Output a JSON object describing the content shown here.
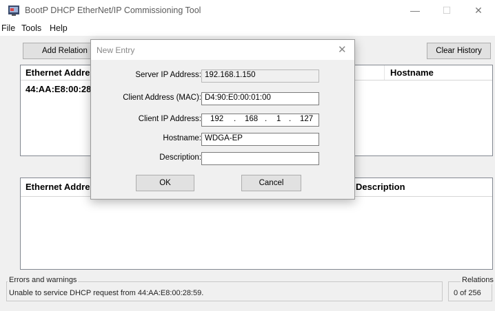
{
  "window": {
    "title": "BootP DHCP EtherNet/IP Commissioning Tool",
    "minimize_glyph": "—",
    "maximize_glyph": "☐",
    "close_glyph": "✕"
  },
  "menu": {
    "file": "File",
    "tools": "Tools",
    "help": "Help"
  },
  "toolbar": {
    "add_relation": "Add Relation",
    "clear_history": "Clear History"
  },
  "top_list": {
    "col_ethernet": "Ethernet Address",
    "col_hostname": "Hostname",
    "rows": [
      {
        "ethernet": "44:AA:E8:00:28:59"
      }
    ]
  },
  "bottom_list": {
    "col_ethernet": "Ethernet Address",
    "col_description": "Description"
  },
  "errors": {
    "label": "Errors and warnings",
    "message": "Unable to service DHCP request from 44:AA:E8:00:28:59."
  },
  "relations": {
    "label": "Relations",
    "count": "0 of 256"
  },
  "dialog": {
    "title": "New Entry",
    "close_glyph": "✕",
    "server_ip_label": "Server IP Address:",
    "server_ip_value": "192.168.1.150",
    "mac_label": "Client Address (MAC):",
    "mac_value": "D4:90:E0:00:01:00",
    "client_ip_label": "Client IP Address:",
    "client_ip": [
      "192",
      "168",
      "1",
      "127"
    ],
    "hostname_label": "Hostname:",
    "hostname_value": "WDGA-EP",
    "description_label": "Description:",
    "description_value": "",
    "ok": "OK",
    "cancel": "Cancel"
  },
  "colors": {
    "accent": "#0078d7",
    "window_bg": "#f0f0f0",
    "list_bg": "#ffffff"
  }
}
